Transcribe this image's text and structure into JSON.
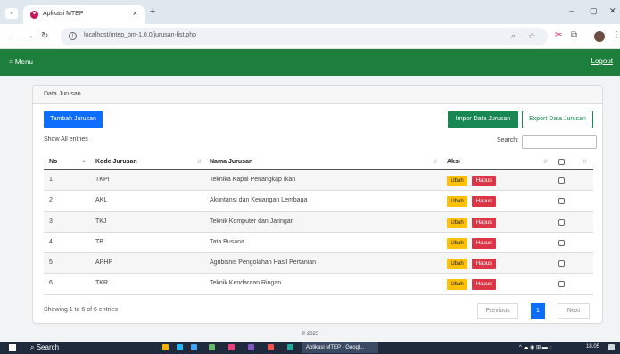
{
  "browser": {
    "tab_title": "Aplikasi MTEP",
    "tab_close": "×",
    "new_tab": "+",
    "url": "localhost/mtep_bm-1.0.0/jurusan-list.php"
  },
  "navbar": {
    "menu_label": "≡ Menu",
    "logout_label": "Logout",
    "color": "#1e7e3c"
  },
  "card": {
    "title": "Data Jurusan",
    "add_button": "Tambah Jurusan",
    "import_button": "Impor Data Jurusan",
    "export_button": "Export Data Jurusan",
    "show_entries": "Show All entries",
    "search_label": "Search:"
  },
  "table": {
    "headers": [
      "No",
      "Kode Jurusan",
      "Nama Jurusan",
      "Aksi"
    ],
    "ubah_label": "Ubah",
    "hapus_label": "Hapus",
    "rows": [
      {
        "no": "1",
        "kode": "TKPI",
        "nama": "Teknika Kapal Penangkap Ikan"
      },
      {
        "no": "2",
        "kode": "AKL",
        "nama": "Akuntansi dan Keuangan Lembaga"
      },
      {
        "no": "3",
        "kode": "TKJ",
        "nama": "Teknik Komputer dan Jaringan"
      },
      {
        "no": "4",
        "kode": "TB",
        "nama": "Tata Busana"
      },
      {
        "no": "5",
        "kode": "APHP",
        "nama": "Agribisnis Pengolahan Hasil Pertanian"
      },
      {
        "no": "6",
        "kode": "TKR",
        "nama": "Teknik Kendaraan Ringan"
      }
    ]
  },
  "pagination": {
    "info": "Showing 1 to 6 of 6 entries",
    "previous": "Previous",
    "current": "1",
    "next": "Next"
  },
  "footer": "© 2025",
  "taskbar": {
    "search": "Search",
    "app_label": "Aplikasi MTEP - Googl...",
    "time": "18.05"
  }
}
